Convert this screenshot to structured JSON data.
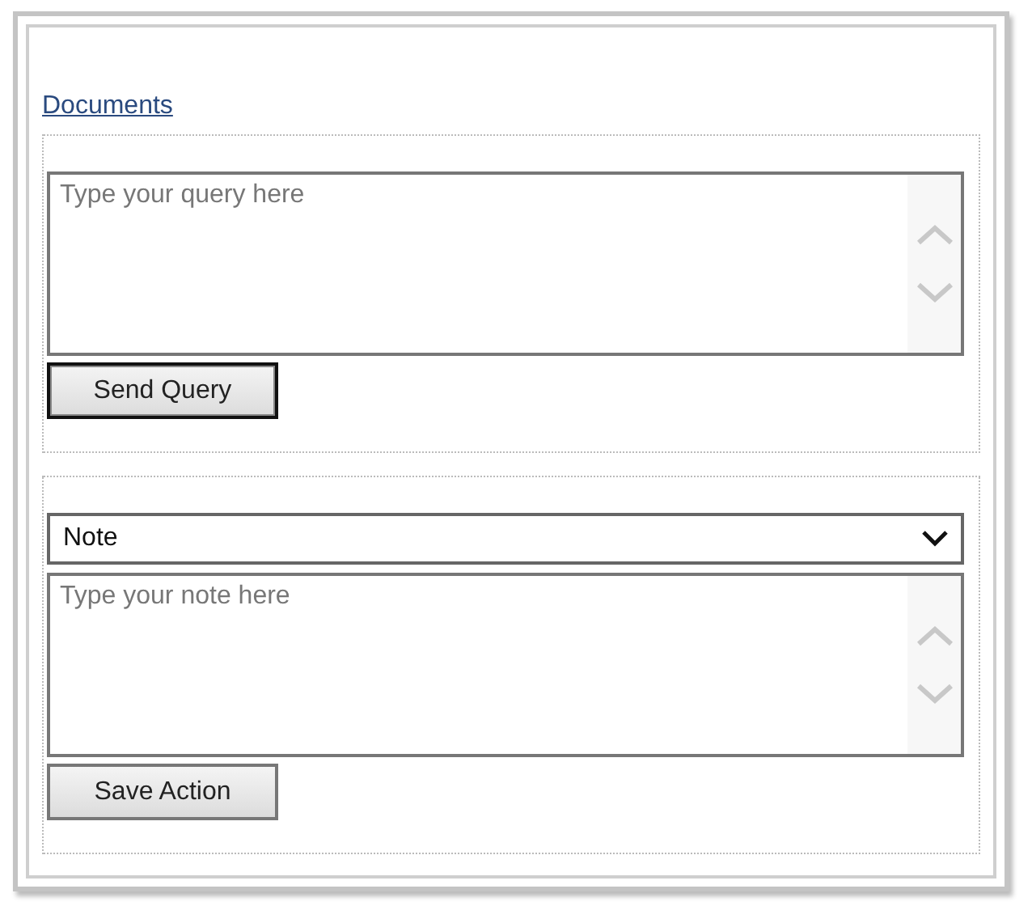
{
  "link": "Documents",
  "query_section": {
    "placeholder": "Type your query here",
    "button": {
      "label": "Send Query",
      "focused": true
    }
  },
  "action_section": {
    "select": {
      "value": "Note"
    },
    "placeholder": "Type your note here",
    "button": {
      "label": "Save Action",
      "focused": false
    }
  }
}
